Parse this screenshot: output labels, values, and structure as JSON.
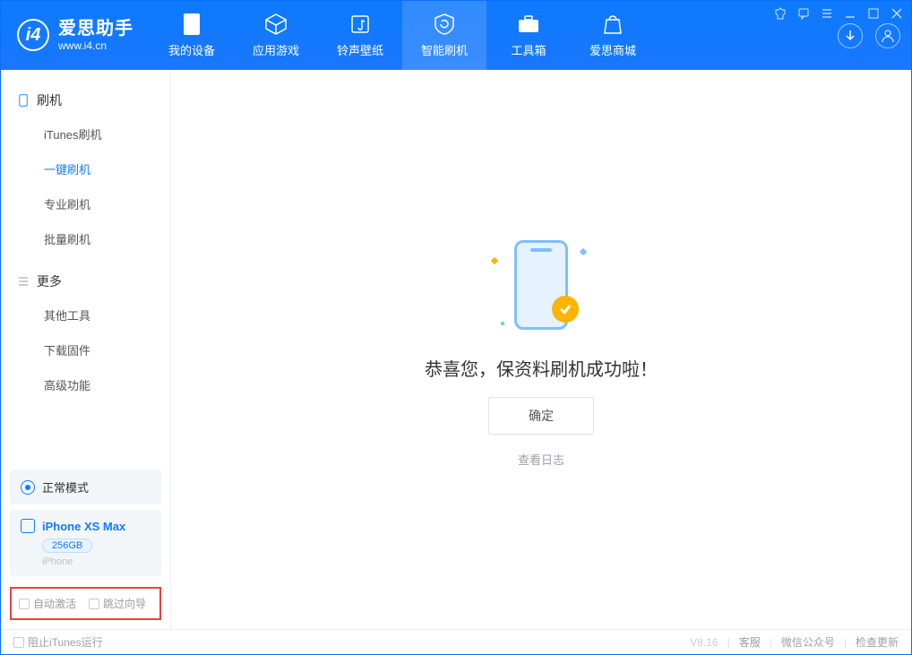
{
  "app": {
    "name": "爱思助手",
    "url": "www.i4.cn"
  },
  "nav": {
    "my_device": "我的设备",
    "apps_games": "应用游戏",
    "ringtones": "铃声壁纸",
    "smart_flash": "智能刷机",
    "toolbox": "工具箱",
    "store": "爱思商城"
  },
  "sidebar": {
    "group1_title": "刷机",
    "g1_items": [
      "iTunes刷机",
      "一键刷机",
      "专业刷机",
      "批量刷机"
    ],
    "group2_title": "更多",
    "g2_items": [
      "其他工具",
      "下载固件",
      "高级功能"
    ],
    "status_label": "正常模式",
    "device_name": "iPhone XS Max",
    "device_storage": "256GB",
    "device_type": "iPhone",
    "chk_auto_activate": "自动激活",
    "chk_skip_guide": "跳过向导"
  },
  "main": {
    "success_text": "恭喜您，保资料刷机成功啦！",
    "confirm": "确定",
    "view_log": "查看日志"
  },
  "footer": {
    "block_itunes": "阻止iTunes运行",
    "version": "V8.16",
    "support": "客服",
    "wechat": "微信公众号",
    "check_update": "检查更新"
  }
}
